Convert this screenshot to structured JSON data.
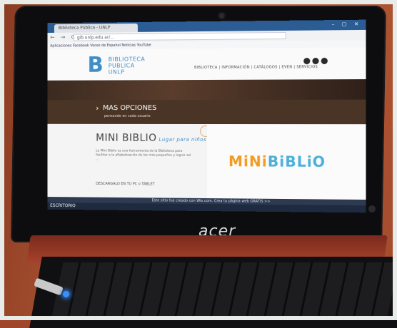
{
  "browser": {
    "tab_title": "Biblioteca Pública - UNLP",
    "url": "gib.unlp.edu.ar/..."
  },
  "bookmarks_text": "Aplicaciones   Facebook   Voces de   Español   Noticias   YouTube",
  "site": {
    "logo_line1": "BIBLIOTECA",
    "logo_line2": "PUBLICA",
    "logo_line3": "UNLP",
    "nav": "BIBLIOTECA  |  INFORMACIÓN  |  CATÁLOGOS  |  EVEN  |  SERVICIOS",
    "more_options_title": "MAS OPCIONES",
    "more_options_sub": "pensando en cada usuario",
    "minibiblio_title": "MINI BIBLIO",
    "minibiblio_tagline": "Lugar para niños",
    "minibiblio_text": "La Mini Biblio es una herramienta de la Biblioteca para facilitar a la alfabetización de los más pequeños y lograr así ...",
    "minibiblio_link": "DESCARGALO EN TU PC o TABLET",
    "mini_logo_left": "MiNi",
    "mini_logo_right": "BiBLiO"
  },
  "notification": "Este sitio fue creado con Wix.com. Crea tu página web GRATIS >>",
  "taskbar_start": "ESCRITORIO",
  "laptop_brand": "acer",
  "colors": {
    "accent_blue": "#3f8ec7",
    "orange": "#f29b22",
    "led_blue": "#3f8ef7"
  }
}
